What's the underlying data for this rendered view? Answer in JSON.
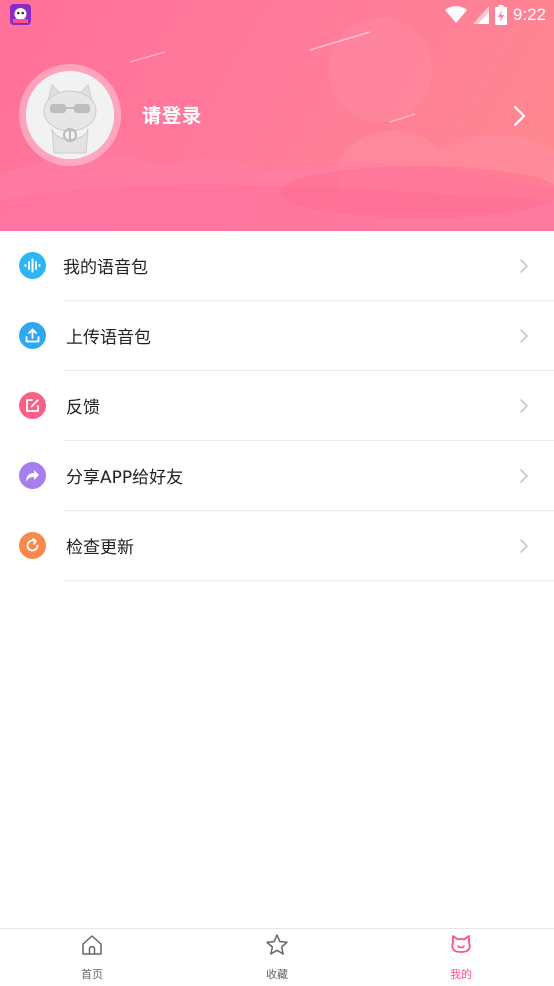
{
  "status_bar": {
    "time": "9:22",
    "icons": [
      "app-icon",
      "wifi-icon",
      "signal-icon",
      "battery-icon"
    ]
  },
  "profile": {
    "login_label": "请登录"
  },
  "menu": {
    "items": [
      {
        "label": "我的语音包",
        "icon": "voice-wave-icon",
        "color": "#2fb4f5"
      },
      {
        "label": "上传语音包",
        "icon": "upload-icon",
        "color": "#2fa8f0"
      },
      {
        "label": "反馈",
        "icon": "edit-icon",
        "color": "#fb5f86"
      },
      {
        "label": "分享APP给好友",
        "icon": "share-icon",
        "color": "#a77ef0"
      },
      {
        "label": "检查更新",
        "icon": "refresh-icon",
        "color": "#f9894a"
      }
    ]
  },
  "tabbar": {
    "tabs": [
      {
        "label": "首页",
        "icon": "home-icon",
        "active": false
      },
      {
        "label": "收藏",
        "icon": "star-icon",
        "active": false
      },
      {
        "label": "我的",
        "icon": "cat-face-icon",
        "active": true
      }
    ]
  },
  "colors": {
    "header_gradient_start": "#ff6f9a",
    "header_gradient_end": "#ff8a8e",
    "accent": "#ff4f86",
    "divider": "#ececec"
  }
}
